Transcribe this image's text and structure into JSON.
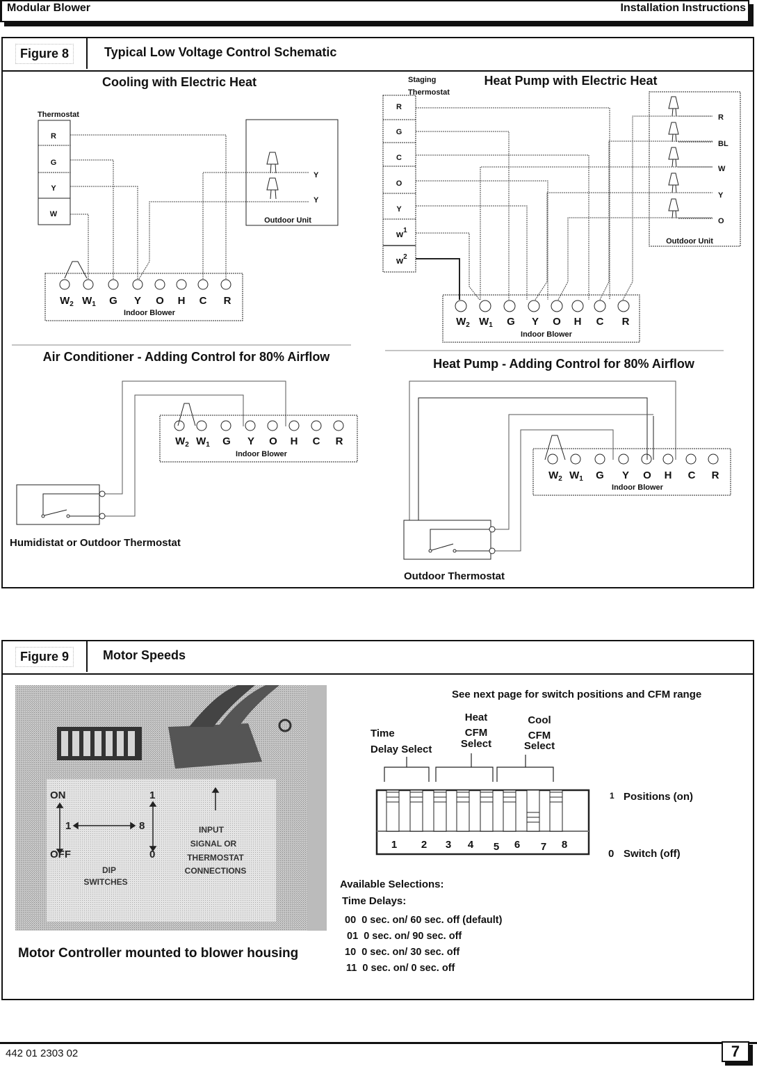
{
  "header": {
    "left": "Modular Blower",
    "right": "Installation Instructions"
  },
  "figure8": {
    "tag": "Figure 8",
    "title": "Typical Low Voltage Control Schematic",
    "cooling": {
      "title": "Cooling with Electric Heat",
      "thermostat_label": "Thermostat",
      "thermostat_terminals": [
        "R",
        "G",
        "Y",
        "W"
      ],
      "outdoor_unit_label": "Outdoor Unit",
      "outdoor_terminals": [
        "Y",
        "Y"
      ],
      "blower_label": "Indoor Blower"
    },
    "heatpump": {
      "title": "Heat Pump with Electric Heat",
      "thermostat_label_1": "Staging",
      "thermostat_label_2": "Thermostat",
      "thermostat_terminals": [
        "R",
        "G",
        "C",
        "O",
        "Y",
        "W1",
        "W2"
      ],
      "outdoor_unit_label": "Outdoor Unit",
      "outdoor_terminals": [
        "R",
        "BL",
        "W",
        "Y",
        "O"
      ],
      "blower_label": "Indoor Blower"
    },
    "ac_80": {
      "title": "Air Conditioner - Adding Control for 80% Airflow",
      "device_label": "Humidistat or Outdoor Thermostat",
      "blower_label": "Indoor Blower"
    },
    "hp_80": {
      "title": "Heat Pump - Adding Control for 80% Airflow",
      "device_label": "Outdoor Thermostat",
      "blower_label": "Indoor Blower"
    },
    "blower_terminals": [
      "W2",
      "W1",
      "G",
      "Y",
      "O",
      "H",
      "C",
      "R"
    ]
  },
  "figure9": {
    "tag": "Figure 9",
    "title": "Motor Speeds",
    "photo": {
      "caption": "Motor Controller mounted to blower housing",
      "labels": {
        "on": "ON",
        "off": "OFF",
        "one": "1",
        "eight": "8",
        "pos1": "1",
        "pos0": "0",
        "dip": "DIP",
        "switches": "SWITCHES",
        "input": "INPUT",
        "signal": "SIGNAL OR",
        "thermostat": "THERMOSTAT",
        "connections": "CONNECTIONS"
      }
    },
    "note": "See next page for switch positions and CFM range",
    "groups": {
      "time_1": "Time",
      "time_2": "Delay Select",
      "heat_1": "Heat",
      "heat_2": "CFM",
      "heat_3": "Select",
      "cool_1": "Cool",
      "cool_2": "CFM",
      "cool_3": "Select"
    },
    "switches": [
      {
        "number": "1",
        "position": 1
      },
      {
        "number": "2",
        "position": 1
      },
      {
        "number": "3",
        "position": 1
      },
      {
        "number": "4",
        "position": 1
      },
      {
        "number": "5",
        "position": 1
      },
      {
        "number": "6",
        "position": 1
      },
      {
        "number": "7",
        "position": 0
      },
      {
        "number": "8",
        "position": 1
      }
    ],
    "legend_on_num": "1",
    "legend_on": "Positions (on)",
    "legend_off_num": "0",
    "legend_off": "Switch (off)",
    "available_title": "Available Selections:",
    "time_delays_title": "Time Delays:",
    "time_delays": [
      {
        "code": "00",
        "text": "0 sec. on/ 60 sec. off (default)"
      },
      {
        "code": "01",
        "text": "0 sec. on/ 90 sec. off"
      },
      {
        "code": "10",
        "text": "0 sec. on/ 30 sec. off"
      },
      {
        "code": "11",
        "text": "0 sec. on/ 0 sec. off"
      }
    ]
  },
  "footer": {
    "doc_id": "442 01 2303 02",
    "page": "7"
  }
}
